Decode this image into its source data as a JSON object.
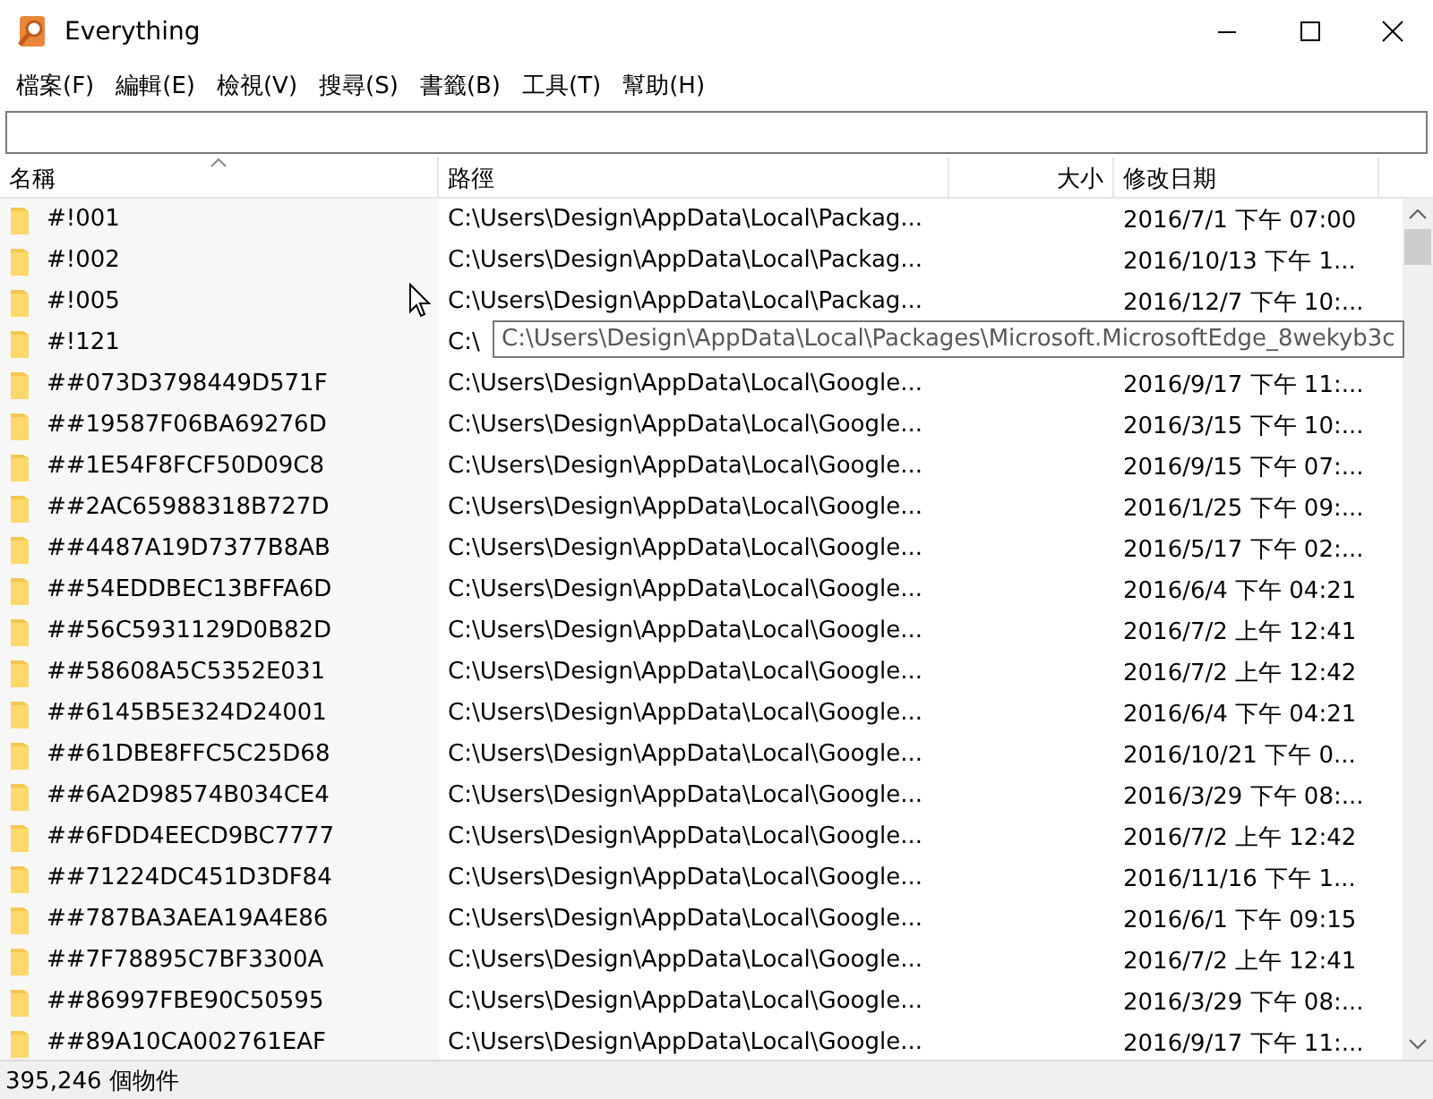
{
  "window": {
    "title": "Everything"
  },
  "menu": [
    "檔案(F)",
    "編輯(E)",
    "檢視(V)",
    "搜尋(S)",
    "書籤(B)",
    "工具(T)",
    "幫助(H)"
  ],
  "columns": [
    {
      "label": "名稱",
      "sorted": true
    },
    {
      "label": "路徑",
      "sorted": false
    },
    {
      "label": "大小",
      "sorted": false
    },
    {
      "label": "修改日期",
      "sorted": false
    }
  ],
  "rows": [
    {
      "name": "#!001",
      "path": "C:\\Users\\Design\\AppData\\Local\\Packag...",
      "date": "2016/7/1 下午 07:00"
    },
    {
      "name": "#!002",
      "path": "C:\\Users\\Design\\AppData\\Local\\Packag...",
      "date": "2016/10/13 下午 1..."
    },
    {
      "name": "#!005",
      "path": "C:\\Users\\Design\\AppData\\Local\\Packag...",
      "date": "2016/12/7 下午 10:..."
    },
    {
      "name": "#!121",
      "path": "C:\\"
    },
    {
      "name": "##073D3798449D571F",
      "path": "C:\\Users\\Design\\AppData\\Local\\Google...",
      "date": "2016/9/17 下午 11:..."
    },
    {
      "name": "##19587F06BA69276D",
      "path": "C:\\Users\\Design\\AppData\\Local\\Google...",
      "date": "2016/3/15 下午 10:..."
    },
    {
      "name": "##1E54F8FCF50D09C8",
      "path": "C:\\Users\\Design\\AppData\\Local\\Google...",
      "date": "2016/9/15 下午 07:..."
    },
    {
      "name": "##2AC65988318B727D",
      "path": "C:\\Users\\Design\\AppData\\Local\\Google...",
      "date": "2016/1/25 下午 09:..."
    },
    {
      "name": "##4487A19D7377B8AB",
      "path": "C:\\Users\\Design\\AppData\\Local\\Google...",
      "date": "2016/5/17 下午 02:..."
    },
    {
      "name": "##54EDDBEC13BFFA6D",
      "path": "C:\\Users\\Design\\AppData\\Local\\Google...",
      "date": "2016/6/4 下午 04:21"
    },
    {
      "name": "##56C5931129D0B82D",
      "path": "C:\\Users\\Design\\AppData\\Local\\Google...",
      "date": "2016/7/2 上午 12:41"
    },
    {
      "name": "##58608A5C5352E031",
      "path": "C:\\Users\\Design\\AppData\\Local\\Google...",
      "date": "2016/7/2 上午 12:42"
    },
    {
      "name": "##6145B5E324D24001",
      "path": "C:\\Users\\Design\\AppData\\Local\\Google...",
      "date": "2016/6/4 下午 04:21"
    },
    {
      "name": "##61DBE8FFC5C25D68",
      "path": "C:\\Users\\Design\\AppData\\Local\\Google...",
      "date": "2016/10/21 下午 0..."
    },
    {
      "name": "##6A2D98574B034CE4",
      "path": "C:\\Users\\Design\\AppData\\Local\\Google...",
      "date": "2016/3/29 下午 08:..."
    },
    {
      "name": "##6FDD4EECD9BC7777",
      "path": "C:\\Users\\Design\\AppData\\Local\\Google...",
      "date": "2016/7/2 上午 12:42"
    },
    {
      "name": "##71224DC451D3DF84",
      "path": "C:\\Users\\Design\\AppData\\Local\\Google...",
      "date": "2016/11/16 下午 1..."
    },
    {
      "name": "##787BA3AEA19A4E86",
      "path": "C:\\Users\\Design\\AppData\\Local\\Google...",
      "date": "2016/6/1 下午 09:15"
    },
    {
      "name": "##7F78895C7BF3300A",
      "path": "C:\\Users\\Design\\AppData\\Local\\Google...",
      "date": "2016/7/2 上午 12:41"
    },
    {
      "name": "##86997FBE90C50595",
      "path": "C:\\Users\\Design\\AppData\\Local\\Google...",
      "date": "2016/3/29 下午 08:..."
    },
    {
      "name": "##89A10CA002761EAF",
      "path": "C:\\Users\\Design\\AppData\\Local\\Google...",
      "date": "2016/9/17 下午 11:..."
    }
  ],
  "tooltip": "C:\\Users\\Design\\AppData\\Local\\Packages\\Microsoft.MicrosoftEdge_8wekyb3c",
  "status_bar": "395,246 個物件"
}
